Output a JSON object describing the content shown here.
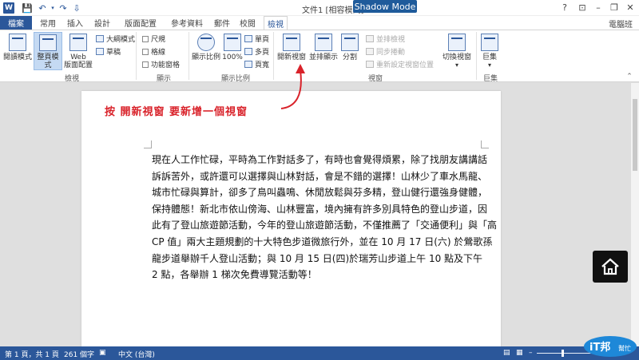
{
  "window": {
    "title": "文件1 [相容模式] - Wor",
    "shadow_mode": "Shadow Mode",
    "user": "電腦班",
    "help": "?",
    "minimize": "–",
    "restore": "❐",
    "close": "✕"
  },
  "quick_access": {
    "save": "💾",
    "undo": "↶",
    "redo": "↷",
    "customize": "⇩"
  },
  "tabs": [
    "檔案",
    "常用",
    "插入",
    "設計",
    "版面配置",
    "參考資料",
    "郵件",
    "校閱",
    "檢視"
  ],
  "ribbon": {
    "views": {
      "read_mode": "閱讀模式",
      "print_layout": "整頁模式",
      "web_layout_1": "Web",
      "web_layout_2": "版面配置",
      "outline": "大綱模式",
      "draft": "草稿",
      "group": "檢視"
    },
    "show": {
      "ruler": "尺規",
      "gridlines": "格線",
      "navigation_pane": "功能窗格",
      "group": "顯示"
    },
    "zoom": {
      "zoom": "顯示比例",
      "hundred": "100%",
      "one_page": "單頁",
      "multiple_pages": "多頁",
      "page_width": "頁寬",
      "group": "顯示比例"
    },
    "window": {
      "new_window": "開新視窗",
      "arrange_all": "並排顯示",
      "split": "分割",
      "side_by_side": "並排檢視",
      "sync_scroll": "同步捲動",
      "reset_position": "重新設定視窗位置",
      "switch_windows": "切換視窗",
      "group": "視窗"
    },
    "macros": {
      "macros": "巨集",
      "group": "巨集"
    }
  },
  "annotation": "按  開新視窗  要新增一個視窗",
  "document": {
    "lines": [
      "現在人工作忙碌，平時為工作對話多了，有時也會覺得煩累，除了找朋友講講話",
      "訴訴苦外，或許還可以選擇與山林對話，會是不錯的選擇！山林少了車水馬龍、",
      "城市忙碌與算計，卻多了鳥叫蟲鳴、休閒放鬆與芬多精，登山健行還強身健體，",
      "保持體態！新北市依山傍海、山林豐富，境內擁有許多別具特色的登山步道，因",
      "此有了登山旅遊節活動，今年的登山旅遊節活動，不僅推薦了「交通便利」與「高",
      "CP 值」兩大主題規劃的十大特色步道微旅行外，並在 10 月 17 日(六) 於鶯歌孫",
      "龍步道舉辦千人登山活動；與 10 月 15 日(四)於瑞芳山步道上午 10 點及下午",
      "2 點，各舉辦 1 梯次免費導覽活動等！"
    ]
  },
  "statusbar": {
    "page": "第 1 頁，共 1 頁",
    "words": "261 個字",
    "language": "中文 (台灣)"
  },
  "logo_text": "iT邦幫忙"
}
